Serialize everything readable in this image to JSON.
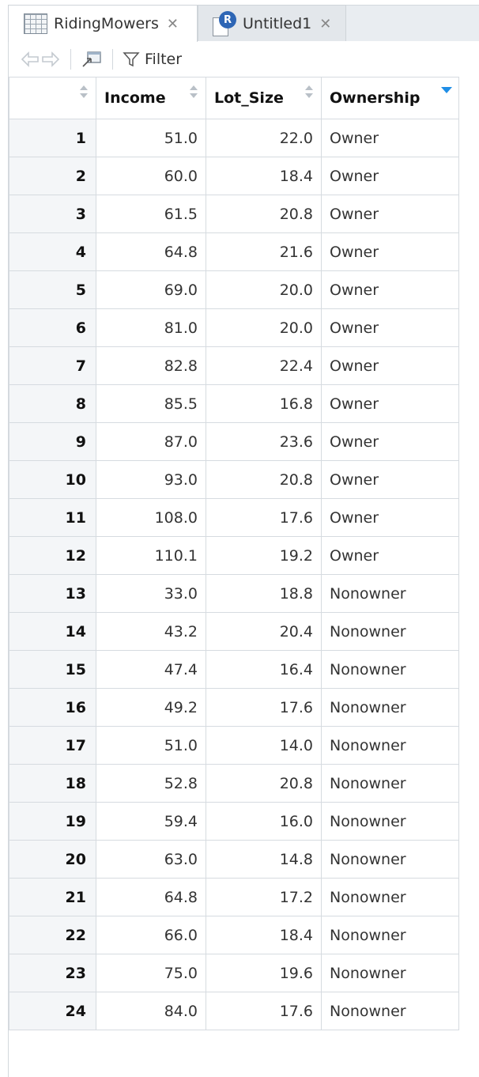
{
  "tabs": [
    {
      "label": "RidingMowers",
      "close": "✕",
      "icon": "data-grid-icon"
    },
    {
      "label": "Untitled1",
      "close": "✕",
      "icon": "r-script-icon"
    }
  ],
  "toolbar": {
    "filter_label": "Filter",
    "back_icon": "back-arrow-icon",
    "forward_icon": "forward-arrow-icon",
    "popout_icon": "popout-window-icon",
    "filter_icon": "funnel-icon"
  },
  "table": {
    "columns": [
      "",
      "Income",
      "Lot_Size",
      "Ownership"
    ],
    "sorted_column": "Ownership",
    "sort_color": "#1f8ee6",
    "rows": [
      [
        "1",
        "51.0",
        "22.0",
        "Owner"
      ],
      [
        "2",
        "60.0",
        "18.4",
        "Owner"
      ],
      [
        "3",
        "61.5",
        "20.8",
        "Owner"
      ],
      [
        "4",
        "64.8",
        "21.6",
        "Owner"
      ],
      [
        "5",
        "69.0",
        "20.0",
        "Owner"
      ],
      [
        "6",
        "81.0",
        "20.0",
        "Owner"
      ],
      [
        "7",
        "82.8",
        "22.4",
        "Owner"
      ],
      [
        "8",
        "85.5",
        "16.8",
        "Owner"
      ],
      [
        "9",
        "87.0",
        "23.6",
        "Owner"
      ],
      [
        "10",
        "93.0",
        "20.8",
        "Owner"
      ],
      [
        "11",
        "108.0",
        "17.6",
        "Owner"
      ],
      [
        "12",
        "110.1",
        "19.2",
        "Owner"
      ],
      [
        "13",
        "33.0",
        "18.8",
        "Nonowner"
      ],
      [
        "14",
        "43.2",
        "20.4",
        "Nonowner"
      ],
      [
        "15",
        "47.4",
        "16.4",
        "Nonowner"
      ],
      [
        "16",
        "49.2",
        "17.6",
        "Nonowner"
      ],
      [
        "17",
        "51.0",
        "14.0",
        "Nonowner"
      ],
      [
        "18",
        "52.8",
        "20.8",
        "Nonowner"
      ],
      [
        "19",
        "59.4",
        "16.0",
        "Nonowner"
      ],
      [
        "20",
        "63.0",
        "14.8",
        "Nonowner"
      ],
      [
        "21",
        "64.8",
        "17.2",
        "Nonowner"
      ],
      [
        "22",
        "66.0",
        "18.4",
        "Nonowner"
      ],
      [
        "23",
        "75.0",
        "19.6",
        "Nonowner"
      ],
      [
        "24",
        "84.0",
        "17.6",
        "Nonowner"
      ]
    ]
  }
}
